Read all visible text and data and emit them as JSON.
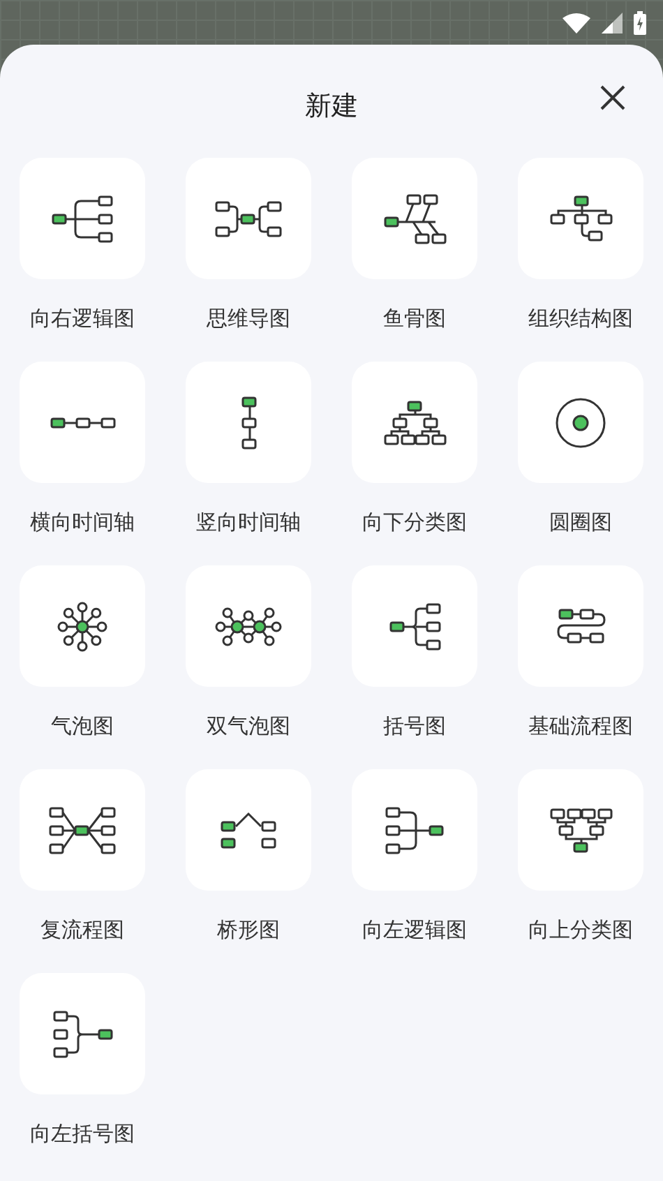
{
  "dialog": {
    "title": "新建"
  },
  "templates": [
    {
      "label": "向右逻辑图"
    },
    {
      "label": "思维导图"
    },
    {
      "label": "鱼骨图"
    },
    {
      "label": "组织结构图"
    },
    {
      "label": "横向时间轴"
    },
    {
      "label": "竖向时间轴"
    },
    {
      "label": "向下分类图"
    },
    {
      "label": "圆圈图"
    },
    {
      "label": "气泡图"
    },
    {
      "label": "双气泡图"
    },
    {
      "label": "括号图"
    },
    {
      "label": "基础流程图"
    },
    {
      "label": "复流程图"
    },
    {
      "label": "桥形图"
    },
    {
      "label": "向左逻辑图"
    },
    {
      "label": "向上分类图"
    },
    {
      "label": "向左括号图"
    }
  ]
}
